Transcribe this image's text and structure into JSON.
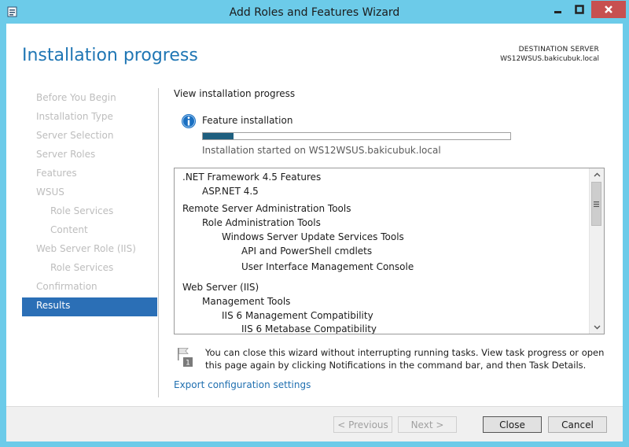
{
  "window": {
    "title": "Add Roles and Features Wizard",
    "accent": "#6ccbe9",
    "controls": {
      "minimize": "minimize-icon",
      "maximize": "maximize-icon",
      "close": "close-icon"
    }
  },
  "header": {
    "page_title": "Installation progress",
    "destination_label": "DESTINATION SERVER",
    "destination_server": "WS12WSUS.bakicubuk.local"
  },
  "nav": {
    "items": [
      {
        "label": "Before You Begin",
        "level": 0
      },
      {
        "label": "Installation Type",
        "level": 0
      },
      {
        "label": "Server Selection",
        "level": 0
      },
      {
        "label": "Server Roles",
        "level": 0
      },
      {
        "label": "Features",
        "level": 0
      },
      {
        "label": "WSUS",
        "level": 0
      },
      {
        "label": "Role Services",
        "level": 1
      },
      {
        "label": "Content",
        "level": 1
      },
      {
        "label": "Web Server Role (IIS)",
        "level": 0
      },
      {
        "label": "Role Services",
        "level": 1
      },
      {
        "label": "Confirmation",
        "level": 0
      },
      {
        "label": "Results",
        "level": 0,
        "active": true
      }
    ]
  },
  "content": {
    "section_title": "View installation progress",
    "feature_label": "Feature installation",
    "progress": 0.1,
    "started_text": "Installation started on WS12WSUS.bakicubuk.local",
    "list": [
      {
        "text": ".NET Framework 4.5 Features",
        "level": 0
      },
      {
        "text": "ASP.NET 4.5",
        "level": 1
      },
      {
        "text": "Remote Server Administration Tools",
        "level": 0
      },
      {
        "text": "Role Administration Tools",
        "level": 1
      },
      {
        "text": "Windows Server Update Services Tools",
        "level": 2
      },
      {
        "text": "API and PowerShell cmdlets",
        "level": 3
      },
      {
        "text": "User Interface Management Console",
        "level": 3
      },
      {
        "text": "Web Server (IIS)",
        "level": 0
      },
      {
        "text": "Management Tools",
        "level": 1
      },
      {
        "text": "IIS 6 Management Compatibility",
        "level": 2
      },
      {
        "text": "IIS 6 Metabase Compatibility",
        "level": 3
      }
    ],
    "note": "You can close this wizard without interrupting running tasks. View task progress or open this page again by clicking Notifications in the command bar, and then Task Details.",
    "notification_count": "1",
    "export_link": "Export configuration settings"
  },
  "footer": {
    "previous": "< Previous",
    "next": "Next >",
    "close": "Close",
    "cancel": "Cancel"
  }
}
